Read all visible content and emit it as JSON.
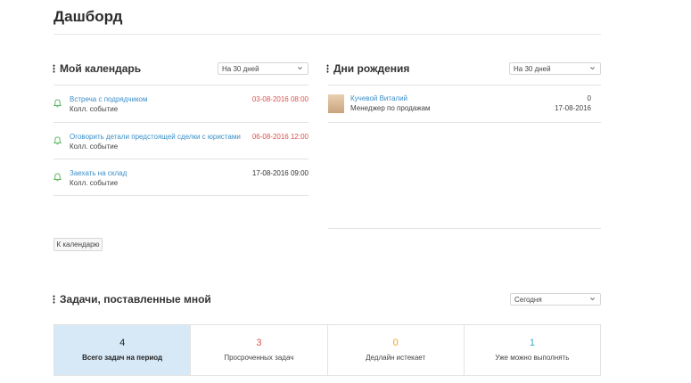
{
  "page": {
    "title": "Дашборд"
  },
  "calendar": {
    "title": "Мой календарь",
    "filter": "На 30 дней",
    "events": [
      {
        "name": "Встреча с подрядчиком",
        "type": "Колл. событие",
        "date": "03-08-2016 08:00",
        "date_color": "#d9534f"
      },
      {
        "name": "Оговорить детали предстоящей сделки с юристами",
        "type": "Колл. событие",
        "date": "06-08-2016 12:00",
        "date_color": "#d9534f"
      },
      {
        "name": "Заехать на склад",
        "type": "Колл. событие",
        "date": "17-08-2016 09:00",
        "date_color": "#333333"
      }
    ],
    "button": "К календарю"
  },
  "birthdays": {
    "title": "Дни рождения",
    "filter": "На 30 дней",
    "items": [
      {
        "name": "Кучевой Виталий",
        "role": "Менеджер по продажам",
        "count": "0",
        "date": "17-08-2016"
      }
    ]
  },
  "tasks": {
    "title": "Задачи, поставленные мной",
    "filter": "Сегодня",
    "stats": [
      {
        "value": "4",
        "label": "Всего задач на период",
        "color": "#222222"
      },
      {
        "value": "3",
        "label": "Просроченных задач",
        "color": "#d9534f"
      },
      {
        "value": "0",
        "label": "Дедлайн истекает",
        "color": "#f0a020"
      },
      {
        "value": "1",
        "label": "Уже можно выполнять",
        "color": "#3aa8c8"
      }
    ]
  },
  "colors": {
    "link": "#3b8fc7",
    "bell": "#4caf50",
    "active_stat_bg": "#d7e9f7"
  },
  "icons": {
    "bell": "bell-icon",
    "drag": "drag-handle-icon",
    "chevron": "chevron-down-icon"
  }
}
